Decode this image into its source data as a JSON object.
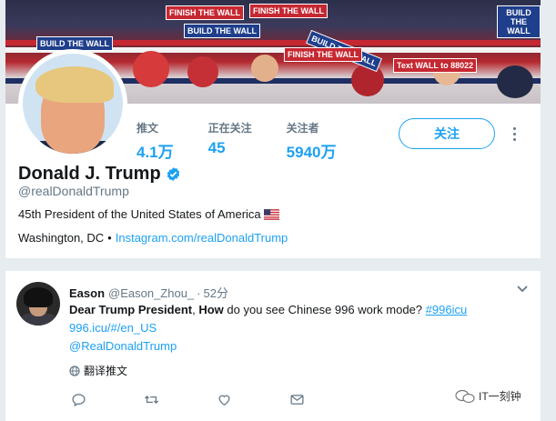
{
  "banner": {
    "signs": [
      "BUILD THE WALL",
      "BUILD THE WALL",
      "FINISH THE WALL",
      "FINISH THE WALL",
      "BUILD THE WALL",
      "Text WALL to 88022",
      "BUILD THE WALL",
      "FINISH THE WALL"
    ]
  },
  "profile": {
    "stats": [
      {
        "label": "推文",
        "value": "4.1万"
      },
      {
        "label": "正在关注",
        "value": "45"
      },
      {
        "label": "关注者",
        "value": "5940万"
      }
    ],
    "follow_label": "关注",
    "name": "Donald J. Trump",
    "handle": "@realDonaldTrump",
    "bio": "45th President of the United States of America",
    "location": "Washington, DC",
    "separator": "•",
    "link": "Instagram.com/realDonaldTrump"
  },
  "tweet": {
    "name": "Eason",
    "handle": "@Eason_Zhou_",
    "dot": "·",
    "time": "52分",
    "text_bold_1": "Dear Trump President",
    "text_plain_1": ", ",
    "text_bold_2": "How",
    "text_plain_2": " do you see Chinese 996 work mode? ",
    "hashtag": "#996icu",
    "line2": "996.icu/#/en_US",
    "line3": "@RealDonaldTrump",
    "translate_label": "翻译推文"
  },
  "watermark": {
    "text": "IT一刻钟"
  },
  "colors": {
    "accent": "#1da1f2",
    "muted": "#657786",
    "background": "#e6ecf0"
  }
}
